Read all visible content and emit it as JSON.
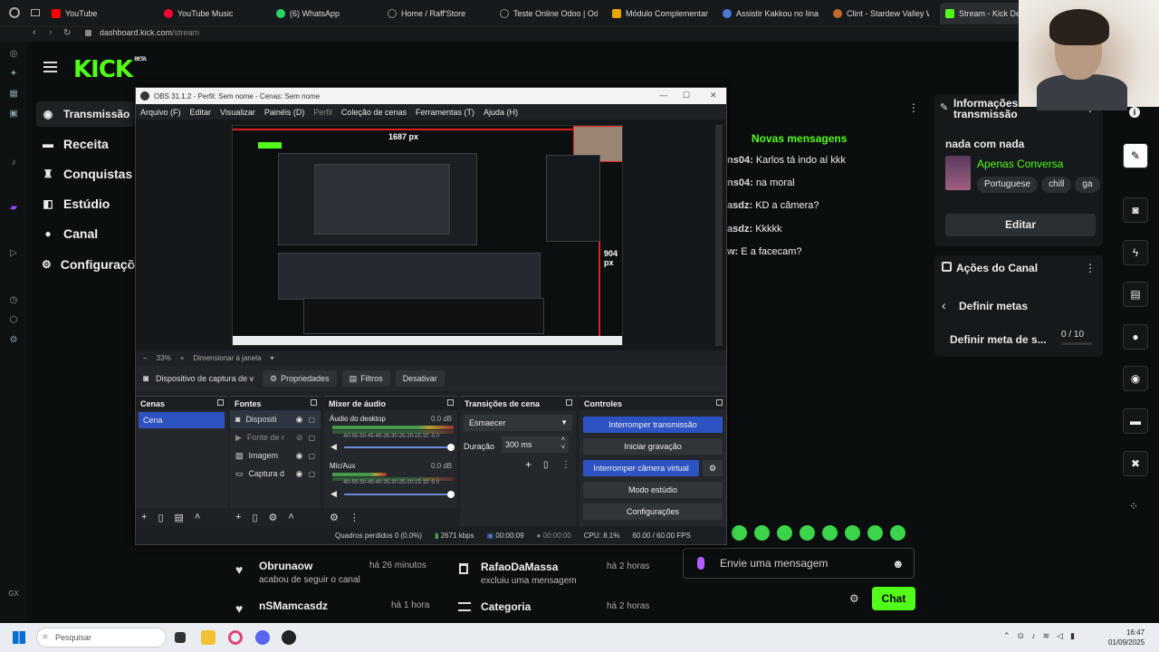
{
  "browser": {
    "tabs": [
      {
        "label": "YouTube",
        "color": "#ff0000"
      },
      {
        "label": "YouTube Music",
        "color": "#ff0033"
      },
      {
        "label": "(6) WhatsApp",
        "color": "#25d366"
      },
      {
        "label": "Home / Raff'Store",
        "color": "#666666"
      },
      {
        "label": "Teste Online Odoo | Od",
        "color": "#666666"
      },
      {
        "label": "Módulo Complementar",
        "color": "#e8a400"
      },
      {
        "label": "Assistir Kakkou no Iinaz",
        "color": "#4d7ad1"
      },
      {
        "label": "Clint - Stardew Valley W",
        "color": "#c06a2a"
      },
      {
        "label": "Stream - Kick Des",
        "color": "#53fc18"
      }
    ],
    "url_host": "dashboard.kick.com",
    "url_path": "/stream"
  },
  "kick": {
    "logo": "KICK",
    "logo_beta": "BETA",
    "nav": [
      {
        "label": "Transmissão",
        "icon": "broadcast-icon"
      },
      {
        "label": "Receita",
        "icon": "money-icon"
      },
      {
        "label": "Conquistas",
        "icon": "trophy-icon"
      },
      {
        "label": "Estúdio",
        "icon": "studio-icon"
      },
      {
        "label": "Canal",
        "icon": "user-icon"
      },
      {
        "label": "Configurações",
        "icon": "gear-icon"
      }
    ],
    "chat": {
      "new_messages": "Novas mensagens",
      "messages": [
        {
          "user": "ns04:",
          "text": "Karlos tá indo aí kkk"
        },
        {
          "user": "ns04:",
          "text": "na moral"
        },
        {
          "user": "asdz:",
          "text": "KD a câmera?"
        },
        {
          "user": "asdz:",
          "text": "Kkkkk"
        },
        {
          "user": "w:",
          "text": "E a facecam?"
        }
      ],
      "input_placeholder": "Envie uma mensagem",
      "send_label": "Chat"
    },
    "stream_info": {
      "title": "Informações da transmissão",
      "stream_title": "nada com nada",
      "category": "Apenas Conversa",
      "tags": [
        "Portuguese",
        "chill",
        "ga"
      ],
      "edit_label": "Editar"
    },
    "channel_actions": {
      "title": "Ações do Canal",
      "back_label": "Definir metas",
      "goal_label": "Definir meta de s...",
      "goal_progress": "0 / 10",
      "goal_current": 0,
      "goal_target": 10
    },
    "activity": [
      {
        "name": "Obrunaow",
        "action": "acabou de seguir o canal",
        "time": "há 26 minutos",
        "icon": "heart-icon"
      },
      {
        "name": "nSMamcasdz",
        "action": "",
        "time": "há 1 hora",
        "icon": "heart-icon"
      },
      {
        "name": "RafaoDaMassa",
        "action": "excluiu uma mensagem",
        "time": "há 2 horas",
        "icon": "trash-icon"
      },
      {
        "name": "Categoria",
        "action": "",
        "time": "há 2 horas",
        "icon": "category-icon"
      }
    ]
  },
  "obs": {
    "title": "OBS 31.1.2 - Perfil: Sem nome - Cenas: Sem nome",
    "menu": [
      "Arquivo (F)",
      "Editar",
      "Visualizar",
      "Painéis (D)",
      "Perfil",
      "Coleção de cenas",
      "Ferramentas (T)",
      "Ajuda (H)"
    ],
    "preview_width_label": "1687 px",
    "preview_height_label": "904 px",
    "zoom": "33%",
    "zoom_mode": "Dimensionar à janela",
    "source_name": "Dispositivo de captura de v",
    "btn_properties": "Propriedades",
    "btn_filters": "Filtros",
    "btn_deactivate": "Desativar",
    "scenes_title": "Cenas",
    "scenes": [
      "Cena"
    ],
    "sources_title": "Fontes",
    "sources": [
      {
        "name": "Dispositi",
        "icon": "camera-icon"
      },
      {
        "name": "Fonte de r",
        "icon": "play-icon"
      },
      {
        "name": "Imagem",
        "icon": "image-icon"
      },
      {
        "name": "Captura d",
        "icon": "monitor-icon"
      }
    ],
    "mixer_title": "Mixer de áudio",
    "mixer": [
      {
        "name": "Áudio do desktop",
        "db": "0.0 dB",
        "scale": "-60-55-50-45-40-35-30-25-20-15-10 -5 0"
      },
      {
        "name": "Mic/Aux",
        "db": "0.0 dB",
        "scale": "-60-55-50-45-40-35-30-25-20-15-10 -5 0"
      }
    ],
    "transitions_title": "Transições de cena",
    "transition": "Esmaecer",
    "duration_label": "Duração",
    "duration": "300 ms",
    "controls_title": "Controles",
    "controls": [
      "Interromper transmissão",
      "Iniciar gravação",
      "Interromper câmera virtual",
      "Modo estúdio",
      "Configurações"
    ],
    "status": {
      "dropped": "Quadros perdidos 0 (0.0%)",
      "bitrate": "2671 kbps",
      "stream_time": "00:00:09",
      "rec_time": "00:00:00",
      "cpu": "CPU: 8.1%",
      "fps": "60.00 / 60.00 FPS"
    }
  },
  "taskbar": {
    "search_placeholder": "Pesquisar",
    "time": "16:47",
    "date": "01/09/2025",
    "os_label": "GX"
  }
}
